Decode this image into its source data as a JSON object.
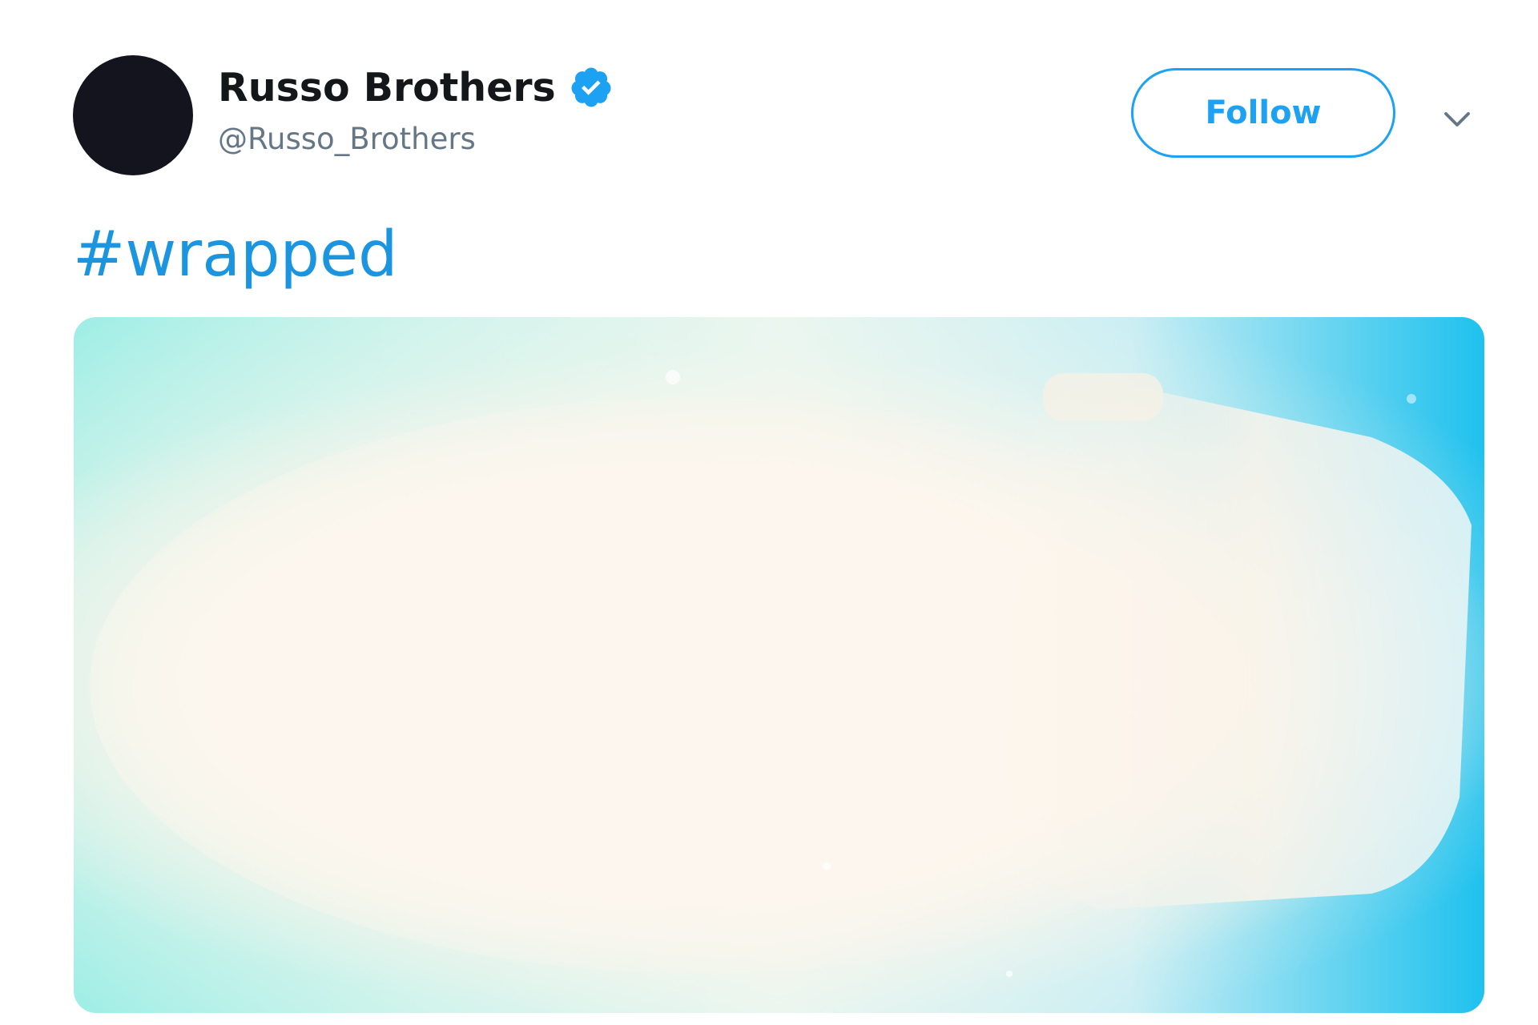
{
  "tweet": {
    "author": {
      "display_name": "Russo Brothers",
      "handle": "@Russo_Brothers",
      "verified": true
    },
    "follow_label": "Follow",
    "text": "#wrapped",
    "icons": {
      "verified": "verified-badge-icon",
      "menu": "chevron-down-icon"
    },
    "colors": {
      "accent": "#1da1f2",
      "hashtag": "#1b95e0",
      "name": "#14171a",
      "handle": "#657786",
      "avatar": "#14141e"
    }
  }
}
